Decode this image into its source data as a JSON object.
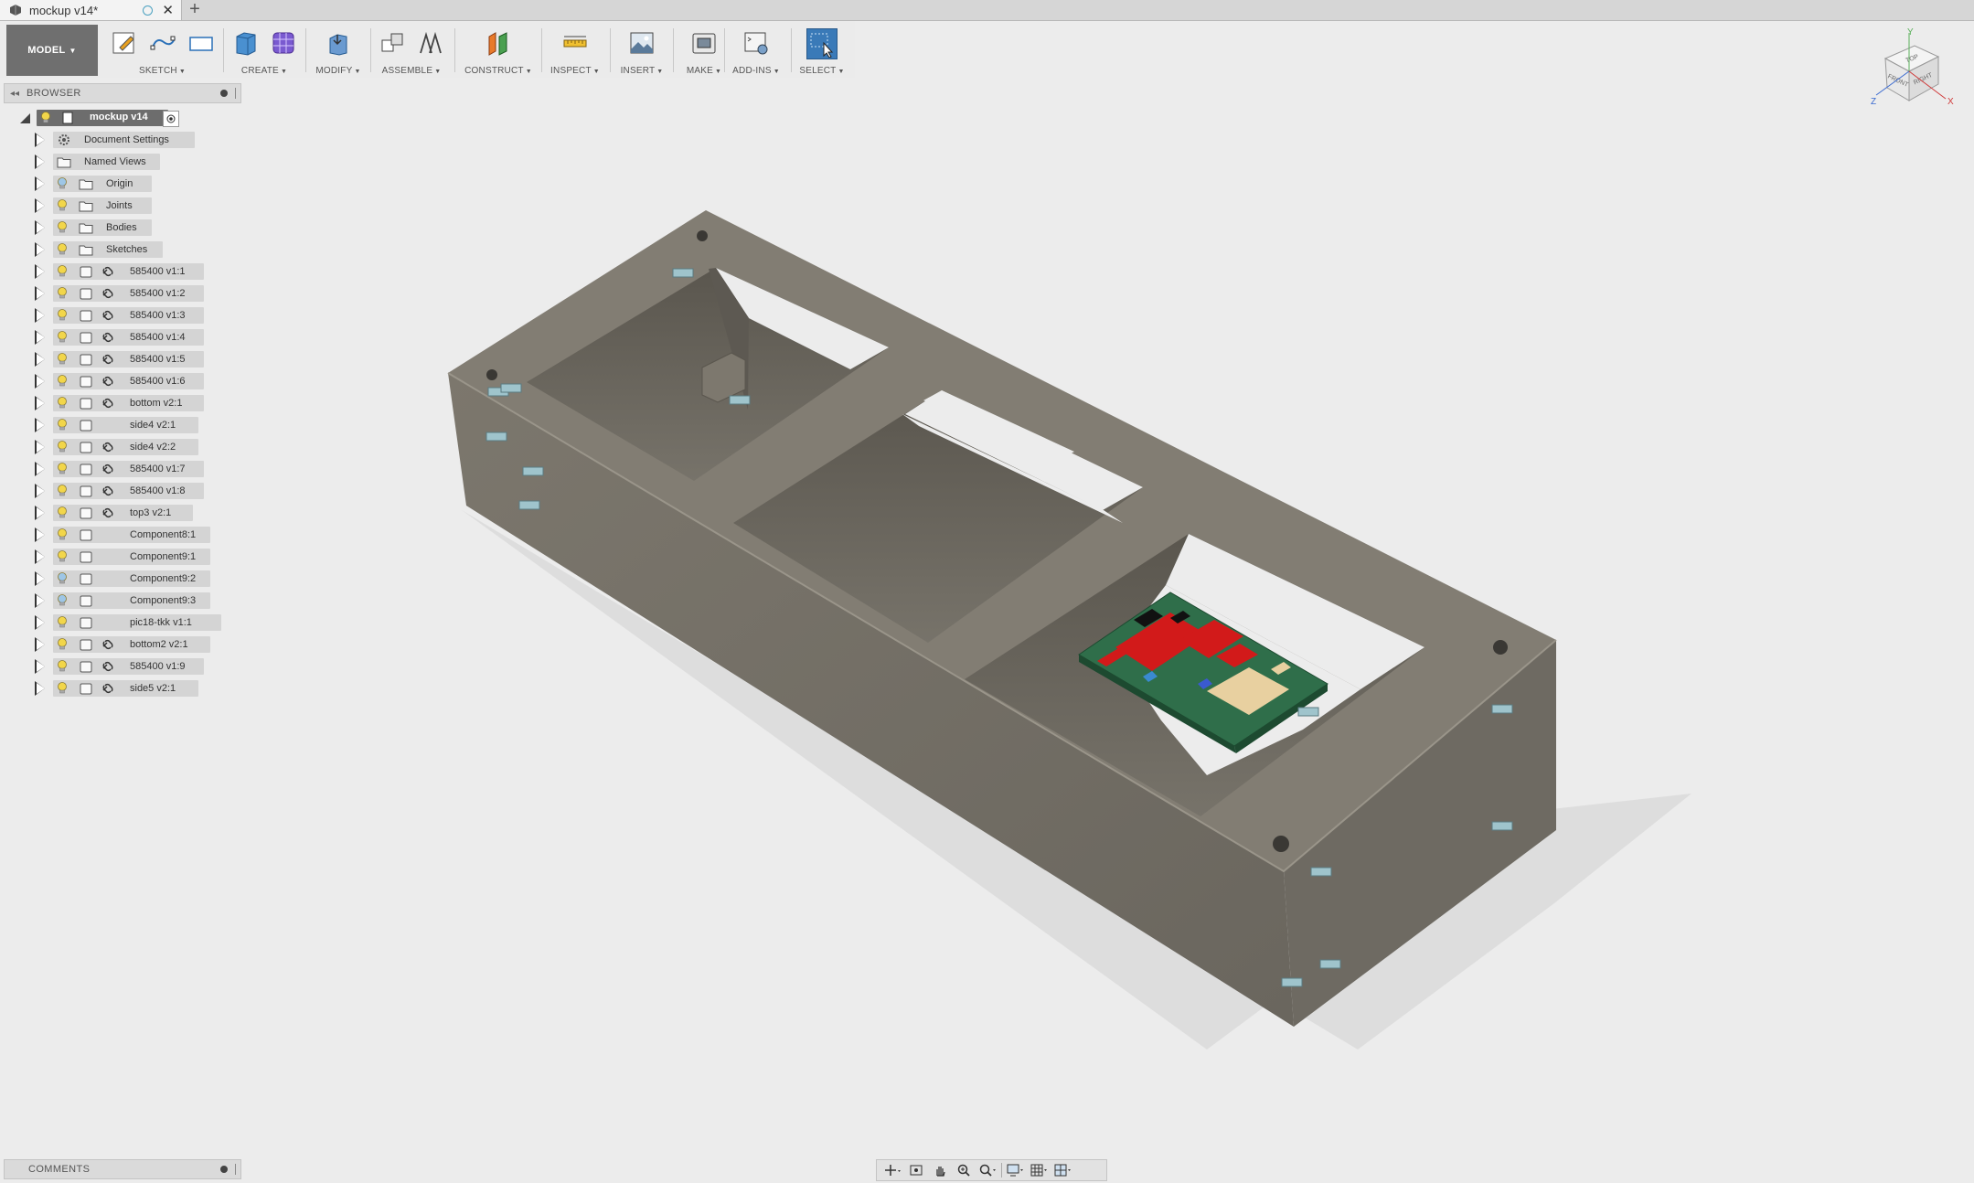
{
  "tab": {
    "title": "mockup v14*",
    "close": "✕",
    "new_tab": "+"
  },
  "toolbar": {
    "workspace": "MODEL",
    "groups": [
      "SKETCH",
      "CREATE",
      "MODIFY",
      "ASSEMBLE",
      "CONSTRUCT",
      "INSPECT",
      "INSERT",
      "MAKE",
      "ADD-INS",
      "SELECT"
    ]
  },
  "browser": {
    "title": "BROWSER",
    "root": "mockup v14",
    "items": [
      {
        "label": "Document Settings",
        "icon": "gear-icon"
      },
      {
        "label": "Named Views",
        "icon": "folder-icon"
      },
      {
        "label": "Origin",
        "icon": "folder-icon",
        "bulb_color": "#9ec6e6"
      },
      {
        "label": "Joints",
        "icon": "folder-icon",
        "bulb_color": "#f2d64a"
      },
      {
        "label": "Bodies",
        "icon": "folder-icon",
        "bulb_color": "#f2d64a"
      },
      {
        "label": "Sketches",
        "icon": "folder-icon",
        "bulb_color": "#f2d64a"
      },
      {
        "label": "585400 v1:1",
        "icon": "component-icon",
        "link": true
      },
      {
        "label": "585400 v1:2",
        "icon": "component-icon",
        "link": true
      },
      {
        "label": "585400 v1:3",
        "icon": "component-icon",
        "link": true
      },
      {
        "label": "585400 v1:4",
        "icon": "component-icon",
        "link": true
      },
      {
        "label": "585400 v1:5",
        "icon": "component-icon",
        "link": true
      },
      {
        "label": "585400 v1:6",
        "icon": "component-icon",
        "link": true
      },
      {
        "label": "bottom v2:1",
        "icon": "component-icon",
        "link": true
      },
      {
        "label": "side4 v2:1",
        "icon": "component-icon",
        "link": false
      },
      {
        "label": "side4 v2:2",
        "icon": "component-icon",
        "link": true
      },
      {
        "label": "585400 v1:7",
        "icon": "component-icon",
        "link": true
      },
      {
        "label": "585400 v1:8",
        "icon": "component-icon",
        "link": true
      },
      {
        "label": "top3 v2:1",
        "icon": "component-icon",
        "link": true
      },
      {
        "label": "Component8:1",
        "icon": "component-icon",
        "link": false
      },
      {
        "label": "Component9:1",
        "icon": "component-icon",
        "link": false
      },
      {
        "label": "Component9:2",
        "icon": "component-icon",
        "link": false,
        "bulb_color": "#9ec6e6"
      },
      {
        "label": "Component9:3",
        "icon": "component-icon",
        "link": false,
        "bulb_color": "#9ec6e6"
      },
      {
        "label": "pic18-tkk v1:1",
        "icon": "component-icon",
        "link": false
      },
      {
        "label": "bottom2 v2:1",
        "icon": "component-icon",
        "link": true
      },
      {
        "label": "585400 v1:9",
        "icon": "component-icon",
        "link": true
      },
      {
        "label": "side5 v2:1",
        "icon": "component-icon",
        "link": true
      }
    ]
  },
  "viewcube": {
    "faces": [
      "TOP",
      "FRONT",
      "RIGHT"
    ],
    "axes": [
      "Y",
      "Z",
      "X"
    ]
  },
  "comments": {
    "title": "COMMENTS"
  },
  "colors": {
    "model_gray": "#7a766d",
    "accent": "#3a7ab8",
    "pcb_green": "#2f6e4a",
    "pcb_red": "#d21a1a"
  }
}
